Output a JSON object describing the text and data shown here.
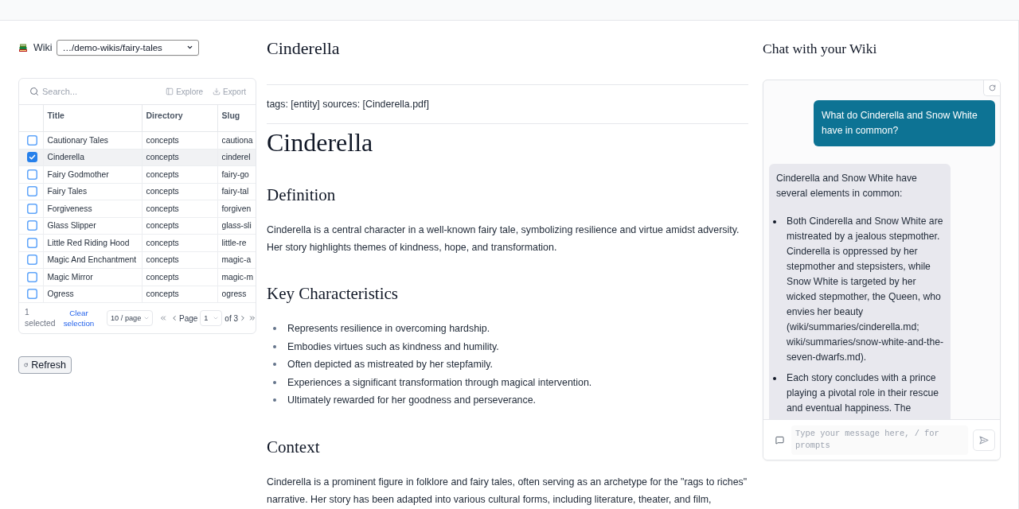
{
  "wiki": {
    "label": "Wiki",
    "path": "…/demo-wikis/fairy-tales"
  },
  "table": {
    "search": {
      "placeholder": "Search..."
    },
    "actions": [
      {
        "kind": "explore",
        "label": "Explore",
        "disabled": true
      },
      {
        "kind": "export",
        "label": "Export",
        "disabled": true
      }
    ],
    "columns": [
      "Title",
      "Directory",
      "Slug"
    ],
    "rows": [
      {
        "title": "Cautionary Tales",
        "directory": "concepts",
        "slug": "cautiona",
        "checked": false,
        "selected": false
      },
      {
        "title": "Cinderella",
        "directory": "concepts",
        "slug": "cinderel",
        "checked": true,
        "selected": true
      },
      {
        "title": "Fairy Godmother",
        "directory": "concepts",
        "slug": "fairy-go",
        "checked": false,
        "selected": false
      },
      {
        "title": "Fairy Tales",
        "directory": "concepts",
        "slug": "fairy-tal",
        "checked": false,
        "selected": false
      },
      {
        "title": "Forgiveness",
        "directory": "concepts",
        "slug": "forgiven",
        "checked": false,
        "selected": false
      },
      {
        "title": "Glass Slipper",
        "directory": "concepts",
        "slug": "glass-sli",
        "checked": false,
        "selected": false
      },
      {
        "title": "Little Red Riding Hood",
        "directory": "concepts",
        "slug": "little-re",
        "checked": false,
        "selected": false
      },
      {
        "title": "Magic And Enchantment",
        "directory": "concepts",
        "slug": "magic-a",
        "checked": false,
        "selected": false
      },
      {
        "title": "Magic Mirror",
        "directory": "concepts",
        "slug": "magic-m",
        "checked": false,
        "selected": false
      },
      {
        "title": "Ogress",
        "directory": "concepts",
        "slug": "ogress",
        "checked": false,
        "selected": false
      }
    ],
    "footer": {
      "selection": "1 selected",
      "clear": "Clear selection",
      "page_size": "10 / page",
      "page_label": "Page",
      "page": "1",
      "page_count": "of 3"
    }
  },
  "refresh_button": {
    "label": "Refresh"
  },
  "article": {
    "title": "Cinderella",
    "meta": "tags: [entity] sources: [Cinderella.pdf]",
    "heading": "Cinderella",
    "sections": [
      {
        "kind": "paragraph",
        "heading": "Definition",
        "text": "Cinderella is a central character in a well-known fairy tale, symbolizing resilience and virtue amidst adversity. Her story highlights themes of kindness, hope, and transformation."
      },
      {
        "kind": "list",
        "heading": "Key Characteristics",
        "items": [
          "Represents resilience in overcoming hardship.",
          "Embodies virtues such as kindness and humility.",
          "Often depicted as mistreated by her stepfamily.",
          "Experiences a significant transformation through magical intervention.",
          "Ultimately rewarded for her goodness and perseverance."
        ]
      },
      {
        "kind": "paragraph",
        "heading": "Context",
        "text": "Cinderella is a prominent figure in folklore and fairy tales, often serving as an archetype for the \"rags to riches\" narrative. Her story has been adapted into various cultural forms, including literature, theater, and film,"
      }
    ]
  },
  "chat": {
    "title": "Chat with your Wiki",
    "messages": [
      {
        "kind": "user",
        "text": "What do Cinderella and Snow White have in common?"
      },
      {
        "kind": "assistant",
        "text": "Cinderella and Snow White have several elements in common:",
        "items": [
          "Both Cinderella and Snow White are mistreated by a jealous stepmother. Cinderella is oppressed by her stepmother and stepsisters, while Snow White is targeted by her wicked stepmother, the Queen, who envies her beauty (wiki/summaries/cinderella.md; wiki/summaries/snow-white-and-the-seven-dwarfs.md).",
          "Each story concludes with a prince playing a pivotal role in their rescue and eventual happiness. The"
        ]
      }
    ],
    "input": {
      "placeholder": "Type your message here, / for prompts"
    }
  }
}
